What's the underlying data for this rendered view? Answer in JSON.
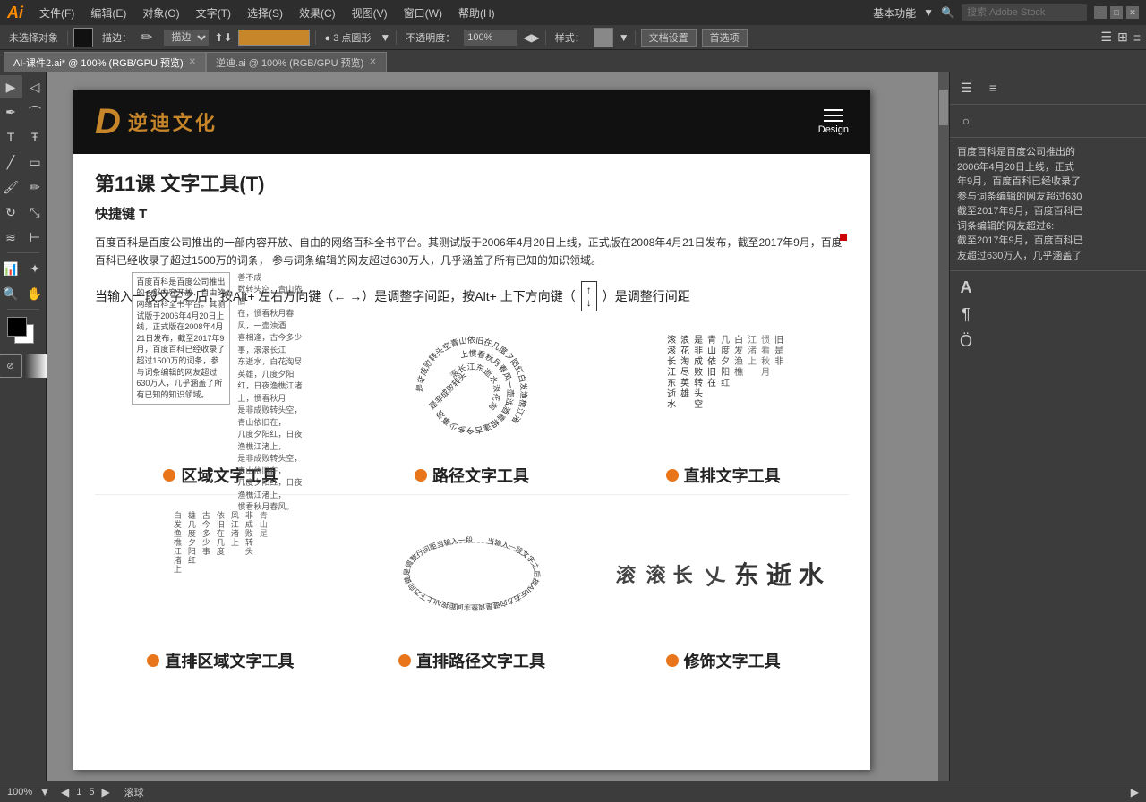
{
  "app": {
    "logo": "Ai",
    "logo_color": "#ff8c00"
  },
  "top_menu": {
    "items": [
      "文件(F)",
      "编辑(E)",
      "对象(O)",
      "文字(T)",
      "选择(S)",
      "效果(C)",
      "视图(V)",
      "窗口(W)",
      "帮助(H)"
    ],
    "right_label": "基本功能",
    "search_placeholder": "搜索 Adobe Stock"
  },
  "toolbar": {
    "no_selection": "未选择对象",
    "fill_mode": "描边：",
    "point_type": "● 3 点圆形",
    "opacity_label": "不透明度：",
    "opacity_value": "100%",
    "style_label": "样式：",
    "doc_settings": "文档设置",
    "preferences": "首选项"
  },
  "tabs": [
    {
      "label": "AI-课件2.ai* @ 100% (RGB/GPU 预览)",
      "active": true
    },
    {
      "label": "逆迪.ai @ 100% (RGB/GPU 预览)",
      "active": false
    }
  ],
  "document": {
    "header": {
      "logo_d": "D",
      "logo_text": "逆迪文化",
      "menu_label": "Design"
    },
    "lesson": {
      "title": "第11课   文字工具(T)",
      "shortcut": "快捷键 T",
      "description": "百度百科是百度公司推出的一部内容开放、自由的网络百科全书平台。其测试版于2006年4月20日上线，正式版在2008年4月21日发布，截至2017年9月，百度百科已经收录了超过1500万的词条，\n参与词条编辑的网友超过630万人，几乎涵盖了所有已知的知识领域。",
      "arrow_desc": "当输入一段文字之后，按Alt+ 左右方向键（← →）是调整字间距，按Alt+ 上下方向键（",
      "arrow_desc2": "）是调整行间距"
    },
    "tool_types": {
      "area": "区域文字工具",
      "path": "路径文字工具",
      "vertical": "直排文字工具"
    },
    "bottom_tool_types": {
      "vert_area": "直排区域文字工具",
      "vert_path": "直排路径文字工具",
      "decoration": "修饰文字工具"
    },
    "sample_text": "百度百科是百度公司推出的一部内容开放、自由的网络百科全书平台。其测试版于2006年4月20日上线，正式版在2008年4月21日发布，截至2017年9月，百度百科已经收录了超过1500万的词条，参与词条编辑的网友超过630万人，几乎涵盖了所有已知的知识领域。",
    "path_text": "是非成败转头空 青山依旧在 几度夕阳红 白发渔樵 江渚上 惯看秋月春风",
    "vertical_text": "滚滚长江东逝水 浪花淘尽英雄 是非成败转头空 青山依旧在 几度夕阳红 白发渔樵 江渚上 惯看秋月春风 旧是非成败转头空"
  },
  "status_bar": {
    "zoom": "100%",
    "page_info": "< 1 5 >",
    "status": "滚球"
  },
  "right_panel": {
    "text": "百度百科是百度公司推出的\n2006年4月20日上线，正式\n年9月，百度百科已经收录了\n参与词条编辑的网友超过630\n截至2017年9月，百度百科已\n词条编辑的网友超过6:\n截至2017年9月，百度百科已\n友超过630万人，几乎涵盖了"
  }
}
